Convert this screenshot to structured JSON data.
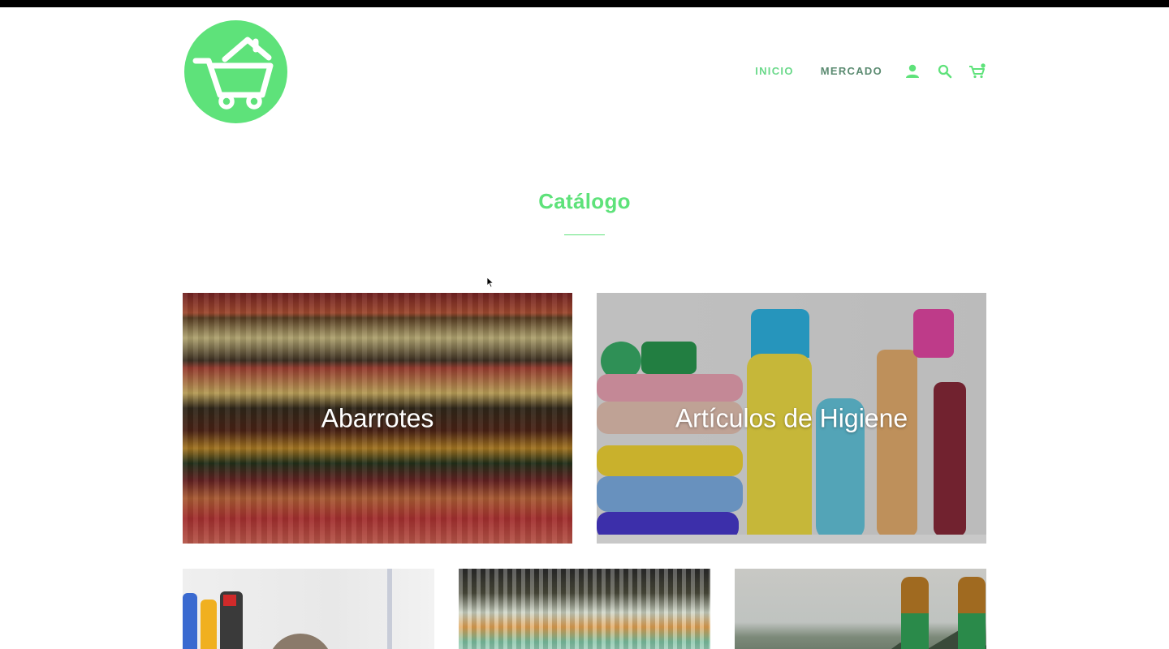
{
  "store": {
    "logo_alt": "Logo de la tienda",
    "brand_color": "#5ee27a"
  },
  "nav": {
    "items": [
      {
        "label": "INICIO",
        "active": true
      },
      {
        "label": "MERCADO",
        "active": false
      }
    ],
    "icons": [
      "account-icon",
      "search-icon",
      "cart-icon"
    ],
    "account_label": "Cuenta",
    "search_label": "Buscar",
    "cart_label": "Carrito"
  },
  "catalog": {
    "title": "Catálogo",
    "collections": [
      {
        "label": "Abarrotes"
      },
      {
        "label": "Artículos de Higiene"
      },
      {
        "label": ""
      },
      {
        "label": ""
      },
      {
        "label": ""
      }
    ]
  }
}
